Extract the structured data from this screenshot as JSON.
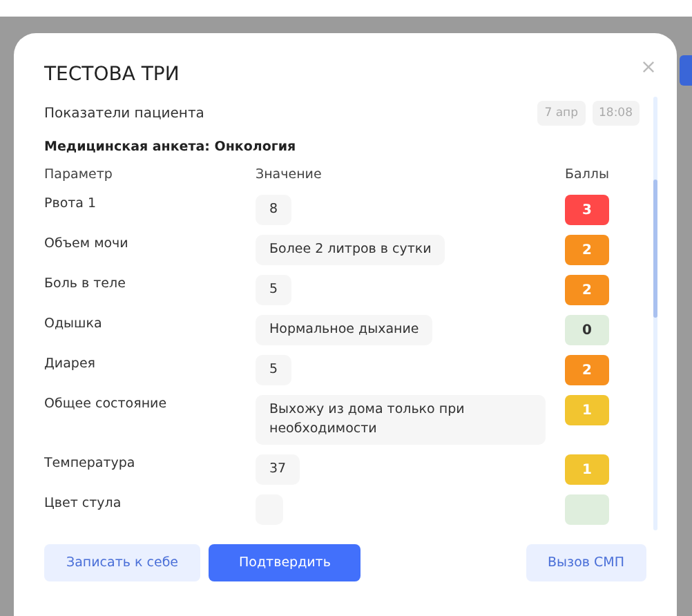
{
  "dialog": {
    "title": "ТЕСТОВА ТРИ",
    "section": {
      "title": "Показатели пациента",
      "date": "7 апр",
      "time": "18:08"
    },
    "form_title": "Медицинская анкета: Онкология",
    "table": {
      "columns": [
        "Параметр",
        "Значение",
        "Баллы"
      ],
      "rows": [
        {
          "parameter": "Рвота 1",
          "value": "8",
          "score": "3",
          "color": "#ff4848"
        },
        {
          "parameter": "Объем мочи",
          "value": "Более 2 литров в сутки",
          "score": "2",
          "color": "#f7901e"
        },
        {
          "parameter": "Боль в теле",
          "value": "5",
          "score": "2",
          "color": "#f7901e"
        },
        {
          "parameter": "Одышка",
          "value": "Нормальное дыхание",
          "score": "0",
          "color": "#dfeedd"
        },
        {
          "parameter": "Диарея",
          "value": "5",
          "score": "2",
          "color": "#f7901e"
        },
        {
          "parameter": "Общее состояние",
          "value": "Выхожу из дома только при необходимости",
          "score": "1",
          "color": "#f2c530"
        },
        {
          "parameter": "Температура",
          "value": "37",
          "score": "1",
          "color": "#f2c530"
        },
        {
          "parameter": "Цвет стула",
          "color": "#dfeedd"
        }
      ]
    },
    "buttons": [
      {
        "label": "Записать к себе",
        "kind": "secondary"
      },
      {
        "label": "Подтвердить",
        "kind": "primary"
      },
      {
        "label": "Вызов СМП",
        "kind": "secondary"
      }
    ]
  }
}
